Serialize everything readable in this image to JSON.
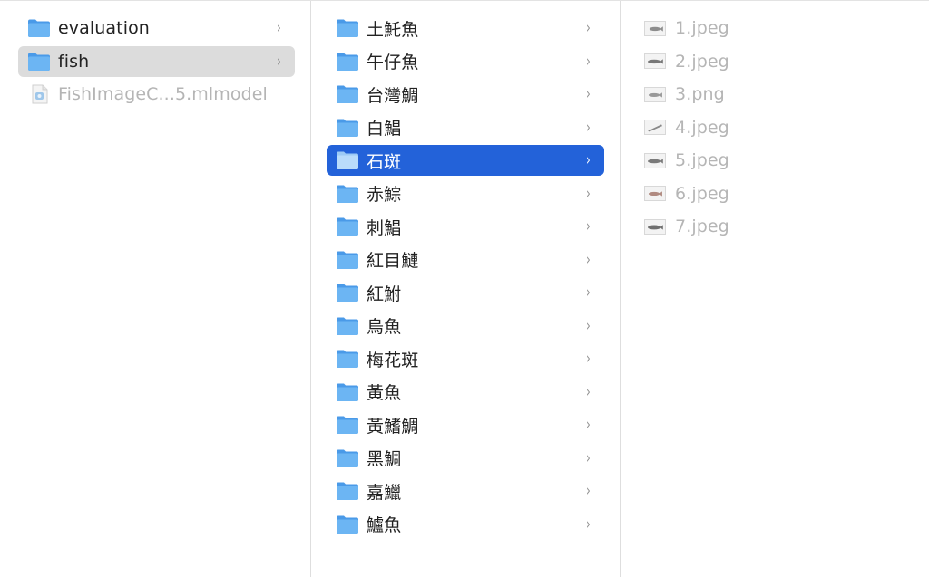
{
  "column1": {
    "items": [
      {
        "label": "evaluation",
        "type": "folder"
      },
      {
        "label": "fish",
        "type": "folder"
      },
      {
        "label": "FishImageC...5.mlmodel",
        "type": "file"
      }
    ]
  },
  "column2": {
    "items": [
      {
        "label": "土魠魚"
      },
      {
        "label": "午仔魚"
      },
      {
        "label": "台灣鯛"
      },
      {
        "label": "白鯧"
      },
      {
        "label": "石斑"
      },
      {
        "label": "赤鯮"
      },
      {
        "label": "刺鯧"
      },
      {
        "label": "紅目鰱"
      },
      {
        "label": "紅鮒"
      },
      {
        "label": "烏魚"
      },
      {
        "label": "梅花斑"
      },
      {
        "label": "黃魚"
      },
      {
        "label": "黃鰭鯛"
      },
      {
        "label": "黑鯛"
      },
      {
        "label": "嘉鱲"
      },
      {
        "label": "鱸魚"
      }
    ]
  },
  "column3": {
    "items": [
      {
        "label": "1.jpeg"
      },
      {
        "label": "2.jpeg"
      },
      {
        "label": "3.png"
      },
      {
        "label": "4.jpeg"
      },
      {
        "label": "5.jpeg"
      },
      {
        "label": "6.jpeg"
      },
      {
        "label": "7.jpeg"
      }
    ]
  },
  "chevron": "›",
  "colors": {
    "selection_blue": "#2362d9",
    "selection_gray": "#dcdcdc",
    "folder": "#5aaaf0"
  }
}
